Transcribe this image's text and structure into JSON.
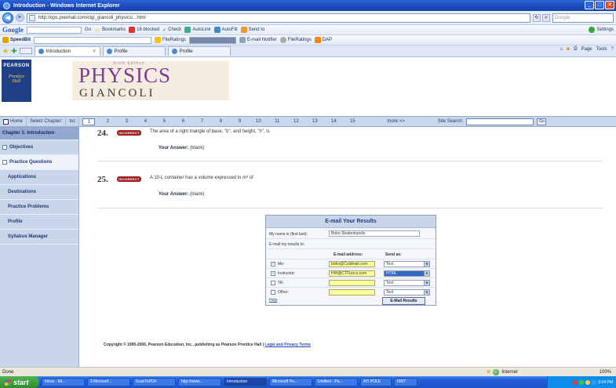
{
  "window": {
    "title": "Introduction - Windows Internet Explorer",
    "min": "_",
    "close": "✕"
  },
  "browser": {
    "back": "◀",
    "forward": "▶",
    "url": "http://ops.prenhall.com/ctgi_giancoli_physics/...html",
    "search_placeholder": "Google",
    "toolbar1": {
      "google": "Google",
      "go": "Go",
      "bookmarks": "Bookmarks",
      "blocked": "16 blocked",
      "check": "Check",
      "autolink": "AutoLink",
      "autofill": "AutoFill",
      "sendto": "Send to",
      "settings": "Settings"
    },
    "toolbar2": {
      "speedbit": "SpeedBit",
      "fileratings": "FileRatings",
      "emailnotifier": "E-mail Notifier",
      "fileratings2": "FileRatings",
      "dap": "DAP"
    },
    "tabs": [
      {
        "label": "Introduction",
        "active": true
      },
      {
        "label": "Profile",
        "active": false
      },
      {
        "label": "Profile",
        "active": false
      }
    ],
    "commands": [
      "Page",
      "Tools"
    ]
  },
  "banner": {
    "publisher_line1": "PEARSON",
    "publisher_line2": "Prentice",
    "publisher_line3": "Hall",
    "edition": "Sixth Edition",
    "title": "PHYSICS",
    "author": "GIANCOLI"
  },
  "chapnav": {
    "home": "Home",
    "select": "Select Chapter:",
    "toc": "toc",
    "current": "1",
    "chapters": [
      "2",
      "3",
      "4",
      "5",
      "6",
      "7",
      "8",
      "9",
      "10",
      "11",
      "12",
      "13",
      "14",
      "15"
    ],
    "more": "more >>",
    "site_search": "Site Search:",
    "go": "Go"
  },
  "sidebar": {
    "chapter": "Chapter 1: Introduction",
    "items": [
      "Objectives",
      "Practice Questions",
      "Applications",
      "Destinations",
      "Practice Problems",
      "Profile",
      "Syllabus Manager"
    ]
  },
  "questions": [
    {
      "number": "24.",
      "status": "INCORRECT",
      "text": "The area of a right triangle of base, \"b\", and height, \"h\", is",
      "answer_label": "Your Answer:",
      "answer": "(blank)"
    },
    {
      "number": "25.",
      "status": "INCORRECT",
      "text": "A 10-L container has a volume expressed in m³ of",
      "answer_label": "Your Answer:",
      "answer": "(blank)"
    }
  ],
  "email": {
    "heading": "E-mail Your Results",
    "name_label": "My name is (first last):",
    "name_value": "Bobo Studentopolis",
    "mail_to": "E-mail my results to:",
    "col_address": "E-mail address:",
    "col_sendas": "Send as:",
    "rows": [
      {
        "label": "Me:",
        "checked": true,
        "address": "bobo@Coldmail.com",
        "format": "Text"
      },
      {
        "label": "Instructor:",
        "checked": true,
        "address": "HW@CTFizzcs.com",
        "format": "HTML"
      },
      {
        "label": "TA:",
        "checked": false,
        "address": "",
        "format": "Text"
      },
      {
        "label": "Other:",
        "checked": false,
        "address": "",
        "format": "Text"
      }
    ],
    "help": "Help",
    "send": "E-Mail Results"
  },
  "footer": {
    "copyright": "Copyright © 1995-2006, Pearson Education, Inc., publishing as Pearson Prentice Hall |",
    "legal": "Legal and Privacy Terms"
  },
  "status": {
    "text": "Done",
    "zone": "Internet",
    "zoom": "100%"
  },
  "taskbar": {
    "start": "start",
    "tasks": [
      "Inbox - Mi...",
      "3 Microsof...",
      "ScanToPDF",
      "http://www...",
      "Introduction",
      "Microsoft Po...",
      "Untitled - Pa...",
      "ATI POLE",
      "0007"
    ],
    "clock": "5:04 PM"
  }
}
